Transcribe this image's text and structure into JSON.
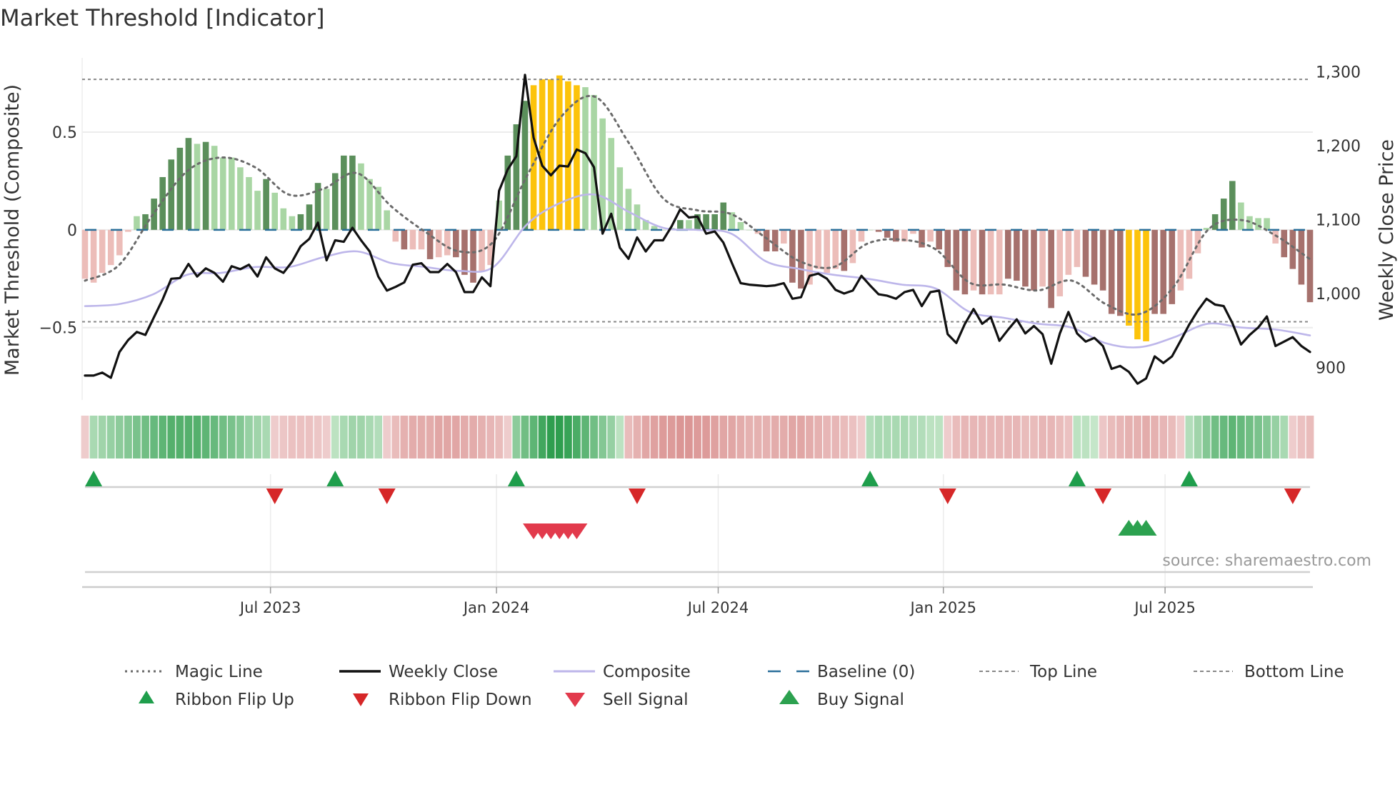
{
  "title": "Market Threshold [Indicator]",
  "source": "source: sharemaestro.com",
  "colors": {
    "bar_dark_green": "#5b8f5b",
    "bar_light_green": "#a9d6a4",
    "bar_dark_red": "#a6716d",
    "bar_light_red": "#ecbdb9",
    "bar_yellow": "#fcc30b",
    "close": "#111111",
    "composite": "#bdb6ea",
    "magic": "#6b6b6b",
    "baseline": "#2a6f9a",
    "threshold": "#888888",
    "flip_up": "#1f9e4c",
    "flip_down": "#d62728",
    "sell": "#e23a4c",
    "buy": "#2ca14f"
  },
  "chart_data": {
    "type": "bar",
    "ylabel_left": "Market Threshold (Composite)",
    "ylabel_right": "Weekly Close Price",
    "ylim_left": [
      -0.87,
      0.88
    ],
    "ylim_right": [
      856,
      1319
    ],
    "left_ticks": [
      {
        "v": 0.5,
        "label": "0.5"
      },
      {
        "v": 0,
        "label": "0"
      },
      {
        "v": -0.5,
        "label": "−0.5"
      }
    ],
    "right_ticks": [
      {
        "v": 1300,
        "label": "1,300"
      },
      {
        "v": 1200,
        "label": "1,200"
      },
      {
        "v": 1100,
        "label": "1,100"
      },
      {
        "v": 1000,
        "label": "1,000"
      },
      {
        "v": 900,
        "label": "900"
      }
    ],
    "x_ticks": [
      {
        "week": 21.5,
        "label": "Jul 2023"
      },
      {
        "week": 47.7,
        "label": "Jan 2024"
      },
      {
        "week": 73.4,
        "label": "Jul 2024"
      },
      {
        "week": 99.5,
        "label": "Jan 2025"
      },
      {
        "week": 125.2,
        "label": "Jul 2025"
      }
    ],
    "top_line": 0.77,
    "bottom_line": -0.47,
    "baseline": 0,
    "composite_bars": [
      -0.25,
      -0.27,
      -0.22,
      -0.18,
      -0.13,
      -0.01,
      0.07,
      0.08,
      0.16,
      0.27,
      0.36,
      0.42,
      0.47,
      0.44,
      0.45,
      0.43,
      0.37,
      0.37,
      0.32,
      0.27,
      0.2,
      0.26,
      0.19,
      0.11,
      0.07,
      0.08,
      0.13,
      0.24,
      0.21,
      0.29,
      0.38,
      0.38,
      0.34,
      0.26,
      0.22,
      0.1,
      -0.06,
      -0.1,
      -0.1,
      -0.1,
      -0.15,
      -0.14,
      -0.13,
      -0.14,
      -0.23,
      -0.27,
      -0.21,
      -0.18,
      0.15,
      0.38,
      0.54,
      0.66,
      0.74,
      0.77,
      0.77,
      0.79,
      0.76,
      0.74,
      0.73,
      0.69,
      0.57,
      0.47,
      0.32,
      0.21,
      0.13,
      0.05,
      0.02,
      0.0,
      0.01,
      0.05,
      0.05,
      0.08,
      0.08,
      0.08,
      0.14,
      0.09,
      0.04,
      0.0,
      -0.02,
      -0.11,
      -0.11,
      -0.07,
      -0.27,
      -0.3,
      -0.28,
      -0.2,
      -0.22,
      -0.2,
      -0.21,
      -0.17,
      -0.06,
      0.0,
      -0.01,
      -0.04,
      -0.06,
      -0.06,
      -0.02,
      -0.09,
      -0.06,
      -0.1,
      -0.19,
      -0.31,
      -0.33,
      -0.31,
      -0.33,
      -0.33,
      -0.33,
      -0.25,
      -0.26,
      -0.29,
      -0.31,
      -0.29,
      -0.4,
      -0.34,
      -0.23,
      -0.19,
      -0.24,
      -0.28,
      -0.31,
      -0.43,
      -0.44,
      -0.49,
      -0.56,
      -0.57,
      -0.43,
      -0.43,
      -0.38,
      -0.31,
      -0.25,
      -0.12,
      0.01,
      0.08,
      0.16,
      0.25,
      0.14,
      0.07,
      0.06,
      0.06,
      -0.07,
      -0.14,
      -0.2,
      -0.28,
      -0.37
    ],
    "bar_shade": "LLLLLLLDDDDDDLDLLLLLLDLLLDDDLDDDLLLLLDLLDLLDDDLLLDDDYYYYYYLLLLLLLLLLLDLDDDDLLLLDDLDDLLLLDLLLDDDLLDLDDDDLDLLDDDDLDLLLDDDDDYYYDDDLLLLDDDLLLLLDDDD",
    "weekly_close": [
      889,
      889,
      893,
      886,
      921,
      937,
      948,
      944,
      968,
      992,
      1020,
      1021,
      1040,
      1023,
      1034,
      1028,
      1016,
      1037,
      1033,
      1039,
      1023,
      1049,
      1034,
      1028,
      1043,
      1064,
      1074,
      1096,
      1045,
      1072,
      1070,
      1089,
      1072,
      1057,
      1023,
      1004,
      1009,
      1015,
      1039,
      1041,
      1029,
      1029,
      1040,
      1029,
      1002,
      1002,
      1022,
      1010,
      1139,
      1168,
      1186,
      1296,
      1211,
      1173,
      1160,
      1173,
      1172,
      1195,
      1190,
      1171,
      1081,
      1108,
      1062,
      1047,
      1076,
      1057,
      1072,
      1072,
      1091,
      1114,
      1103,
      1104,
      1081,
      1084,
      1069,
      1041,
      1014,
      1012,
      1011,
      1010,
      1011,
      1014,
      993,
      995,
      1024,
      1027,
      1020,
      1005,
      1000,
      1004,
      1024,
      1011,
      999,
      997,
      993,
      1002,
      1005,
      983,
      1002,
      1004,
      945,
      933,
      959,
      979,
      959,
      968,
      936,
      951,
      965,
      946,
      956,
      945,
      905,
      946,
      975,
      946,
      935,
      940,
      929,
      898,
      902,
      894,
      878,
      885,
      915,
      906,
      915,
      936,
      958,
      977,
      993,
      985,
      983,
      960,
      931,
      944,
      954,
      969,
      929,
      935,
      941,
      929,
      921
    ],
    "composite_line": [
      -0.39,
      -0.38,
      -0.33,
      -0.23,
      -0.22,
      -0.19,
      -0.19,
      -0.14,
      -0.11,
      -0.17,
      -0.19,
      -0.21,
      -0.19,
      0.03,
      0.14,
      0.18,
      0.09,
      0.01,
      0.0,
      -0.02,
      -0.16,
      -0.2,
      -0.23,
      -0.25,
      -0.28,
      -0.3,
      -0.42,
      -0.45,
      -0.48,
      -0.5,
      -0.58,
      -0.6,
      -0.55,
      -0.48,
      -0.5,
      -0.51,
      -0.54
    ],
    "magic_line": [
      -0.26,
      -0.18,
      0.08,
      0.3,
      0.37,
      0.32,
      0.18,
      0.21,
      0.29,
      0.12,
      -0.01,
      -0.11,
      -0.06,
      0.28,
      0.58,
      0.68,
      0.44,
      0.16,
      0.1,
      0.08,
      -0.04,
      -0.16,
      -0.19,
      -0.07,
      -0.05,
      -0.1,
      -0.27,
      -0.28,
      -0.31,
      -0.26,
      -0.38,
      -0.43,
      -0.29,
      0.0,
      0.05,
      -0.03,
      -0.15
    ],
    "ribbon": [
      -0.15,
      0.25,
      0.3,
      0.35,
      0.4,
      0.45,
      0.5,
      0.55,
      0.6,
      0.65,
      0.7,
      0.7,
      0.7,
      0.7,
      0.65,
      0.6,
      0.55,
      0.5,
      0.45,
      0.35,
      0.3,
      0.25,
      -0.15,
      -0.2,
      -0.25,
      -0.25,
      -0.25,
      -0.2,
      -0.15,
      0.15,
      0.25,
      0.3,
      0.3,
      0.25,
      0.2,
      -0.15,
      -0.3,
      -0.4,
      -0.45,
      -0.45,
      -0.45,
      -0.5,
      -0.5,
      -0.5,
      -0.45,
      -0.45,
      -0.4,
      -0.35,
      -0.3,
      -0.15,
      0.4,
      0.55,
      0.65,
      0.8,
      0.9,
      0.9,
      0.85,
      0.75,
      0.65,
      0.55,
      0.45,
      0.35,
      0.15,
      -0.3,
      -0.4,
      -0.5,
      -0.55,
      -0.6,
      -0.6,
      -0.65,
      -0.65,
      -0.6,
      -0.6,
      -0.55,
      -0.5,
      -0.5,
      -0.45,
      -0.4,
      -0.4,
      -0.4,
      -0.45,
      -0.45,
      -0.5,
      -0.5,
      -0.45,
      -0.4,
      -0.35,
      -0.35,
      -0.3,
      -0.25,
      -0.15,
      0.2,
      0.25,
      0.25,
      0.25,
      0.25,
      0.2,
      0.2,
      0.15,
      0.15,
      -0.15,
      -0.3,
      -0.35,
      -0.35,
      -0.35,
      -0.35,
      -0.35,
      -0.35,
      -0.35,
      -0.3,
      -0.3,
      -0.35,
      -0.35,
      -0.3,
      -0.25,
      0.15,
      0.15,
      0.1,
      -0.2,
      -0.3,
      -0.35,
      -0.4,
      -0.4,
      -0.45,
      -0.4,
      -0.35,
      -0.3,
      -0.15,
      0.2,
      0.3,
      0.45,
      0.55,
      0.6,
      0.65,
      0.6,
      0.55,
      0.5,
      0.45,
      0.35,
      0.25,
      -0.15,
      -0.25,
      -0.3
    ],
    "ribbon_flip_up_weeks": [
      1,
      29,
      50,
      91,
      115,
      128
    ],
    "ribbon_flip_down_weeks": [
      22,
      35,
      64,
      100,
      118,
      140
    ],
    "sell_signal_weeks": [
      52,
      53,
      54,
      55,
      56,
      57
    ],
    "buy_signal_weeks": [
      121,
      122,
      123
    ],
    "legend": [
      {
        "label": "Magic Line",
        "key": "magic"
      },
      {
        "label": "Weekly Close",
        "key": "close"
      },
      {
        "label": "Composite",
        "key": "composite"
      },
      {
        "label": "Baseline (0)",
        "key": "baseline"
      },
      {
        "label": "Top Line",
        "key": "top"
      },
      {
        "label": "Bottom Line",
        "key": "bottom"
      },
      {
        "label": "Ribbon Flip Up",
        "key": "flip_up"
      },
      {
        "label": "Ribbon Flip Down",
        "key": "flip_down"
      },
      {
        "label": "Sell Signal",
        "key": "sell"
      },
      {
        "label": "Buy Signal",
        "key": "buy"
      }
    ]
  }
}
